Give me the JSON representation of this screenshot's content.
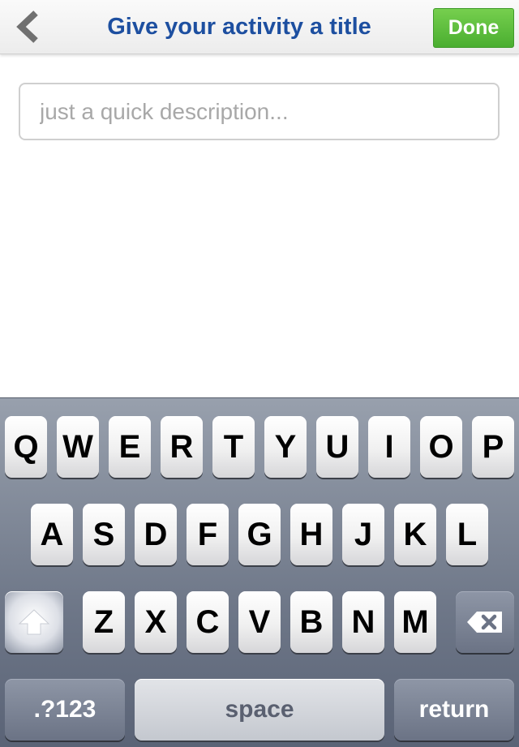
{
  "nav": {
    "title": "Give your activity a title",
    "done_label": "Done",
    "back_icon": "chevron-left-icon"
  },
  "field": {
    "value": "",
    "placeholder": "just a quick description..."
  },
  "keyboard": {
    "row1": [
      "Q",
      "W",
      "E",
      "R",
      "T",
      "Y",
      "U",
      "I",
      "O",
      "P"
    ],
    "row2": [
      "A",
      "S",
      "D",
      "F",
      "G",
      "H",
      "J",
      "K",
      "L"
    ],
    "row3": [
      "Z",
      "X",
      "C",
      "V",
      "B",
      "N",
      "M"
    ],
    "numbers_label": ".?123",
    "space_label": "space",
    "return_label": "return",
    "shift_icon": "shift-arrow-icon",
    "delete_icon": "delete-backspace-icon"
  },
  "colors": {
    "title_blue": "#1d4fa0",
    "done_green": "#5bbd3b",
    "keyboard_bg": "#6e7788"
  }
}
